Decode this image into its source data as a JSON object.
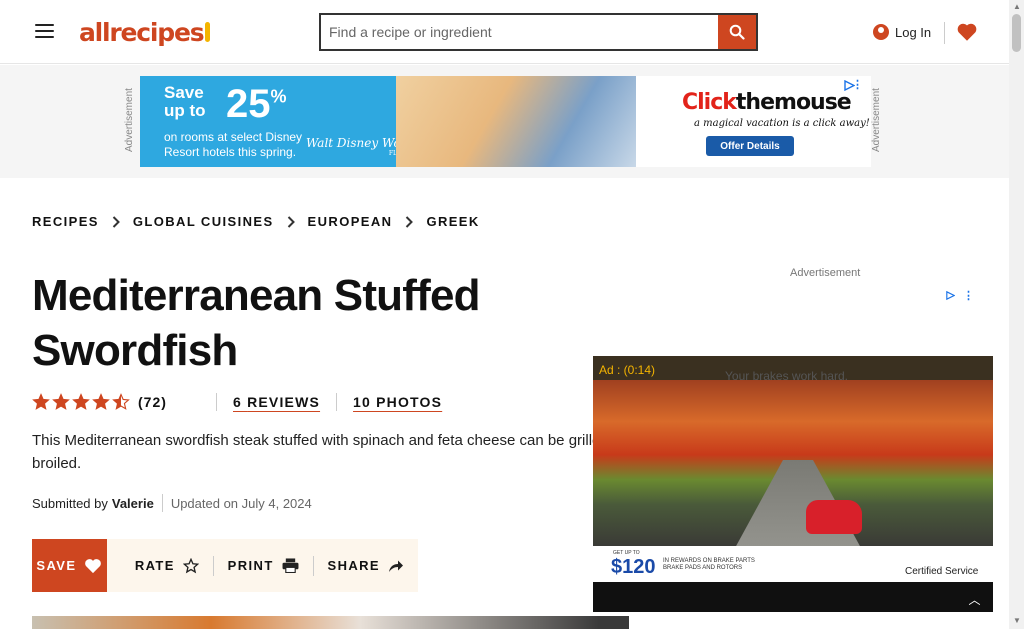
{
  "header": {
    "logo_text": "allrecipes",
    "search_placeholder": "Find a recipe or ingredient",
    "login_label": "Log In"
  },
  "top_ad": {
    "side_label": "Advertisement",
    "save_text": "Save up to",
    "percent": "25",
    "percent_sign": "%",
    "terms": "on rooms at select Disney Resort hotels this spring.",
    "brand": "Walt Disney World",
    "brand_sub": "FLORIDA",
    "right_brand_a": "Click",
    "right_brand_b": "the",
    "right_brand_c": "mouse",
    "tagline": "a magical vacation is a click away!",
    "cta": "Offer Details"
  },
  "breadcrumbs": [
    "RECIPES",
    "GLOBAL CUISINES",
    "EUROPEAN",
    "GREEK"
  ],
  "recipe": {
    "title": "Mediterranean Stuffed Swordfish",
    "rating_stars": 4.5,
    "rating_count": "(72)",
    "reviews_label": "REVIEWS",
    "photos_label": "10 PHOTOS",
    "description": "This Mediterranean swordfish steak stuffed with spinach and feta cheese can be grilled or broiled.",
    "submitted_by_label": "Submitted by",
    "author": "Valerie",
    "updated": "Updated on July 4, 2024"
  },
  "actions": {
    "save": "SAVE",
    "rate": "RATE",
    "print": "PRINT",
    "share": "SHARE"
  },
  "right_ad": {
    "label": "Advertisement",
    "timer": "Ad : (0:14)",
    "caption": "Your brakes work hard.",
    "price_prefix": "GET UP TO",
    "price": "$120",
    "fine_print": "IN REWARDS ON BRAKE PARTS BRAKE PADS AND ROTORS",
    "certified": "Certified Service"
  },
  "colors": {
    "brand": "#ce4620",
    "cream": "#fdf6ec"
  }
}
